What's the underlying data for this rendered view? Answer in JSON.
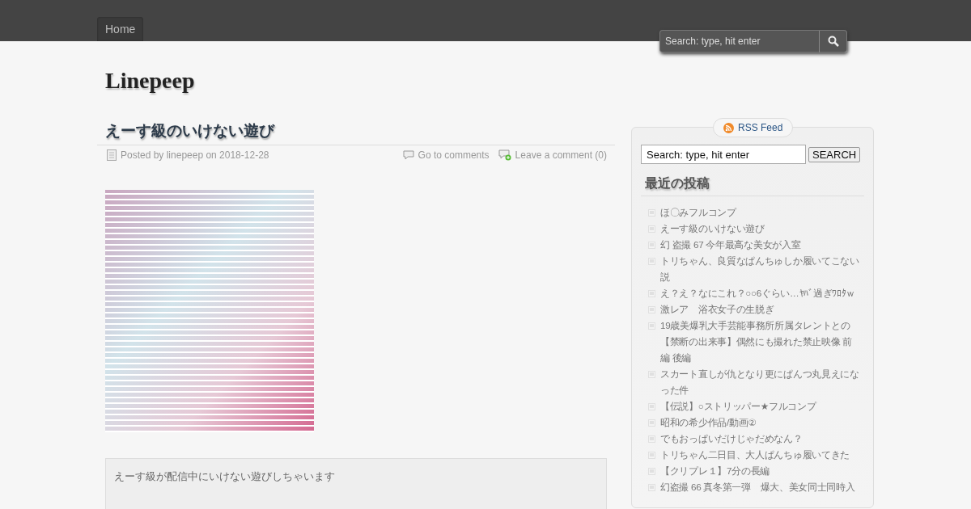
{
  "nav": {
    "items": [
      {
        "label": "Home",
        "selected": true
      }
    ]
  },
  "header_search": {
    "placeholder": "Search: type, hit enter"
  },
  "site_title": "Linepeep",
  "post": {
    "title": "えーす級のいけない遊び",
    "meta": {
      "posted": "Posted by linepeep on 2018-12-28",
      "comments_link": "Go to comments",
      "leave_comment": "Leave a comment (0)"
    },
    "excerpt": "えーす級が配信中にいけない遊びしちゃいます"
  },
  "sidebar": {
    "rss": "RSS Feed",
    "search": {
      "value": "Search: type, hit enter",
      "button": "SEARCH"
    },
    "heading": "最近の投稿",
    "recent_posts": [
      "ほ〇みフルコンプ",
      "えーす級のいけない遊び",
      "幻 盗撮 67 今年最高な美女が入室",
      "トリちゃん、良質なぱんちゅしか履いてこない説",
      "え？え？なにこれ？○○6ぐらい…ﾔﾊﾞ過ぎﾜﾛﾀｗ",
      "激レア　浴衣女子の生脱ぎ",
      "19歳美爆乳大手芸能事務所所属タレントとの【禁断の出来事】偶然にも撮れた禁止映像 前編 後編",
      "スカート直しが仇となり更にぱんつ丸見えになった件",
      "【伝説】○ストリッパー★フルコンプ",
      "昭和の希少作品/動画②",
      "でもおっぱいだけじゃだめなん？",
      "トリちゃん二日目、大人ぱんちゅ履いてきた",
      "【クリプレ１】7分の長編",
      "幻盗撮 66 真冬第一弾　爆大、美女同士同時入"
    ]
  }
}
